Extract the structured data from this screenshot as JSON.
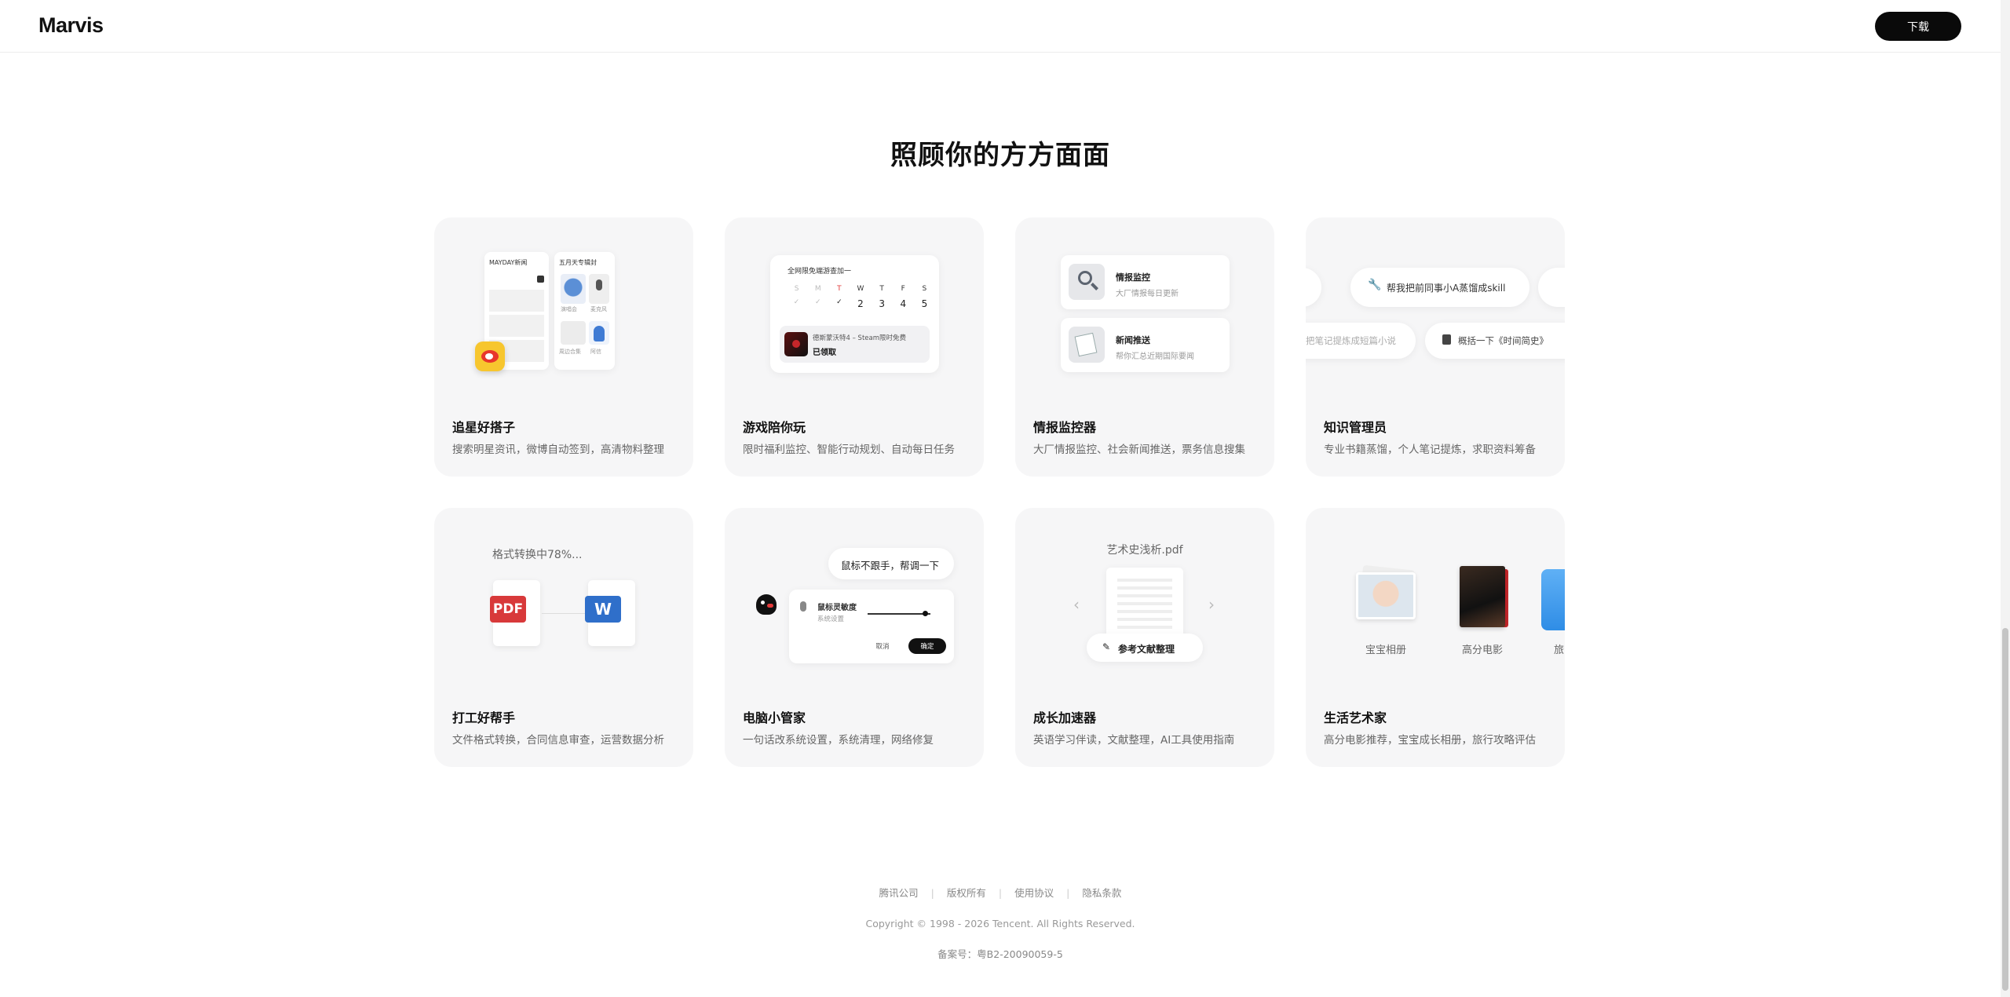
{
  "header": {
    "logo": "Marvis",
    "download_label": "下载"
  },
  "section": {
    "title": "照顾你的方方面面"
  },
  "cards": [
    {
      "title": "追星好搭子",
      "desc": "搜索明星资讯，微博自动签到，高清物料整理",
      "illus": {
        "panel_left": "MAYDAY新闻",
        "panel_right": "五月天专辑封",
        "items": [
          "演唱会",
          "麦克风",
          "周边合集",
          "阿信"
        ]
      }
    },
    {
      "title": "游戏陪你玩",
      "desc": "限时福利监控、智能行动规划、自动每日任务",
      "illus": {
        "header": "全网限免端游查加一",
        "days": [
          "S",
          "M",
          "T",
          "W",
          "T",
          "F",
          "S"
        ],
        "dates": [
          "✓",
          "✓",
          "✓",
          "2",
          "3",
          "4",
          "5"
        ],
        "game": "德斯蒙沃特4 – Steam限时免费",
        "status": "已领取"
      }
    },
    {
      "title": "情报监控器",
      "desc": "大厂情报监控、社会新闻推送，票务信息搜集",
      "illus": {
        "item1_title": "情报监控",
        "item1_sub": "大厂情报每日更新",
        "item2_title": "新闻推送",
        "item2_sub": "帮你汇总近期国际要闻"
      }
    },
    {
      "title": "知识管理员",
      "desc": "专业书籍蒸馏，个人笔记提炼，求职资料筹备",
      "illus": {
        "chip1": "帮我把前同事小A蒸馏成skill",
        "chip2": "把笔记提炼成短篇小说",
        "chip3": "概括一下《时间简史》"
      }
    },
    {
      "title": "打工好帮手",
      "desc": "文件格式转换，合同信息审查，运营数据分析",
      "illus": {
        "status": "格式转换中78%...",
        "from": "PDF",
        "to": "W"
      }
    },
    {
      "title": "电脑小管家",
      "desc": "一句话改系统设置，系统清理，网络修复",
      "illus": {
        "bubble": "鼠标不跟手，帮调一下",
        "setting": "鼠标灵敏度",
        "setting_sub": "系统设置",
        "cancel": "取消",
        "confirm": "确定"
      }
    },
    {
      "title": "成长加速器",
      "desc": "英语学习伴读，文献整理，AI工具使用指南",
      "illus": {
        "file": "艺术史浅析.pdf",
        "action": "参考文献整理"
      }
    },
    {
      "title": "生活艺术家",
      "desc": "高分电影推荐，宝宝成长相册，旅行攻略评估",
      "illus": {
        "album1": "宝宝相册",
        "album2": "高分电影",
        "album3": "旅"
      }
    }
  ],
  "footer": {
    "links": [
      "腾讯公司",
      "版权所有",
      "使用协议",
      "隐私条款"
    ],
    "copyright": "Copyright © 1998 - 2026 Tencent. All Rights Reserved.",
    "icp": "备案号：粤B2-20090059-5"
  }
}
